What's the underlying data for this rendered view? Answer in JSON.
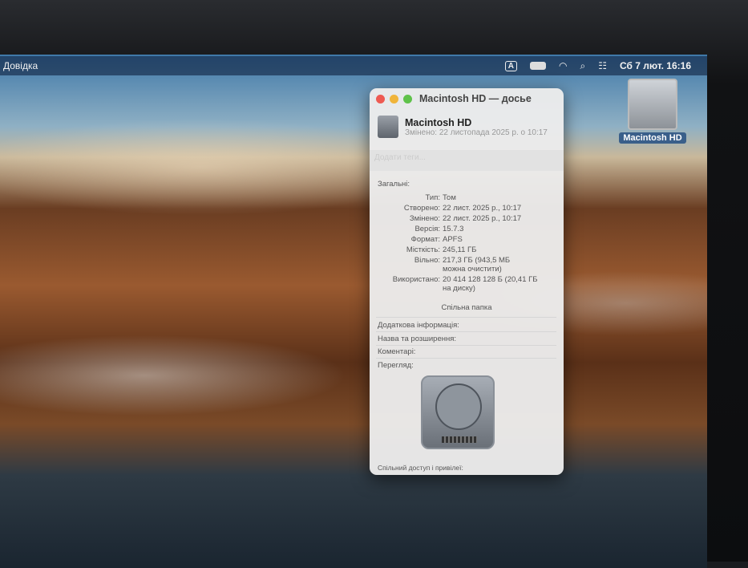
{
  "menubar": {
    "help": "Довідка",
    "input_source": "A",
    "datetime": "Сб 7 лют.  16:16"
  },
  "desktop": {
    "icon_label": "Macintosh HD"
  },
  "window": {
    "title": "Macintosh HD — досье",
    "name": "Macintosh HD",
    "modified": "Змінено: 22 листопада 2025 р. о 10:17",
    "tags_placeholder": "Додати теги...",
    "general": "Загальні:",
    "rows": [
      {
        "k": "Тип:",
        "v": "Том"
      },
      {
        "k": "Створено:",
        "v": "22 лист. 2025 р., 10:17"
      },
      {
        "k": "Змінено:",
        "v": "22 лист. 2025 р., 10:17"
      },
      {
        "k": "Версія:",
        "v": "15.7.3"
      },
      {
        "k": "Формат:",
        "v": "APFS"
      },
      {
        "k": "Місткість:",
        "v": "245,11 ГБ"
      },
      {
        "k": "Вільно:",
        "v": "217,3 ГБ (943,5 МБ можна очистити)"
      },
      {
        "k": "Використано:",
        "v": "20 414 128 128 Б (20,41 ГБ на диску)"
      }
    ],
    "shared_folder": "Спільна папка",
    "sections": [
      "Додаткова інформація:",
      "Назва та розширення:",
      "Коментарі:",
      "Перегляд:"
    ],
    "sharing": "Спільний доступ і привілеї:"
  }
}
